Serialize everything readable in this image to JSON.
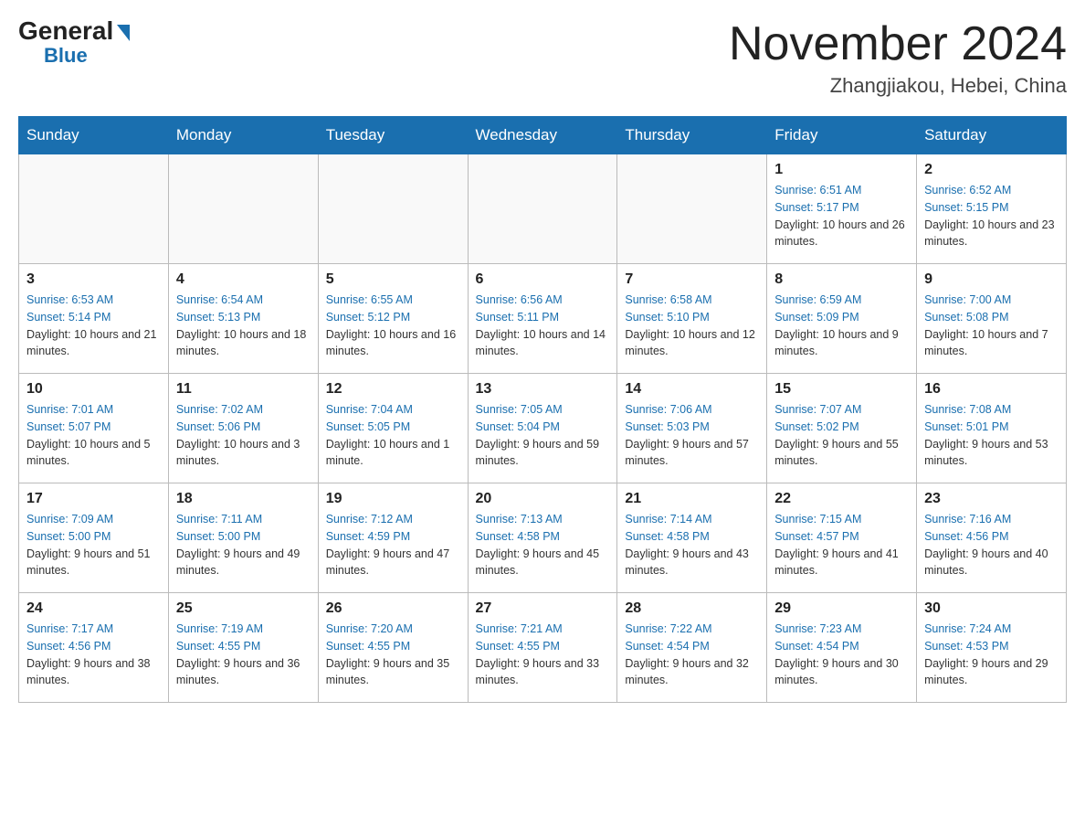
{
  "logo": {
    "general": "General",
    "blue": "Blue",
    "triangle": "▶"
  },
  "title": "November 2024",
  "location": "Zhangjiakou, Hebei, China",
  "weekdays": [
    "Sunday",
    "Monday",
    "Tuesday",
    "Wednesday",
    "Thursday",
    "Friday",
    "Saturday"
  ],
  "weeks": [
    [
      {
        "day": "",
        "sunrise": "",
        "sunset": "",
        "daylight": ""
      },
      {
        "day": "",
        "sunrise": "",
        "sunset": "",
        "daylight": ""
      },
      {
        "day": "",
        "sunrise": "",
        "sunset": "",
        "daylight": ""
      },
      {
        "day": "",
        "sunrise": "",
        "sunset": "",
        "daylight": ""
      },
      {
        "day": "",
        "sunrise": "",
        "sunset": "",
        "daylight": ""
      },
      {
        "day": "1",
        "sunrise": "Sunrise: 6:51 AM",
        "sunset": "Sunset: 5:17 PM",
        "daylight": "Daylight: 10 hours and 26 minutes."
      },
      {
        "day": "2",
        "sunrise": "Sunrise: 6:52 AM",
        "sunset": "Sunset: 5:15 PM",
        "daylight": "Daylight: 10 hours and 23 minutes."
      }
    ],
    [
      {
        "day": "3",
        "sunrise": "Sunrise: 6:53 AM",
        "sunset": "Sunset: 5:14 PM",
        "daylight": "Daylight: 10 hours and 21 minutes."
      },
      {
        "day": "4",
        "sunrise": "Sunrise: 6:54 AM",
        "sunset": "Sunset: 5:13 PM",
        "daylight": "Daylight: 10 hours and 18 minutes."
      },
      {
        "day": "5",
        "sunrise": "Sunrise: 6:55 AM",
        "sunset": "Sunset: 5:12 PM",
        "daylight": "Daylight: 10 hours and 16 minutes."
      },
      {
        "day": "6",
        "sunrise": "Sunrise: 6:56 AM",
        "sunset": "Sunset: 5:11 PM",
        "daylight": "Daylight: 10 hours and 14 minutes."
      },
      {
        "day": "7",
        "sunrise": "Sunrise: 6:58 AM",
        "sunset": "Sunset: 5:10 PM",
        "daylight": "Daylight: 10 hours and 12 minutes."
      },
      {
        "day": "8",
        "sunrise": "Sunrise: 6:59 AM",
        "sunset": "Sunset: 5:09 PM",
        "daylight": "Daylight: 10 hours and 9 minutes."
      },
      {
        "day": "9",
        "sunrise": "Sunrise: 7:00 AM",
        "sunset": "Sunset: 5:08 PM",
        "daylight": "Daylight: 10 hours and 7 minutes."
      }
    ],
    [
      {
        "day": "10",
        "sunrise": "Sunrise: 7:01 AM",
        "sunset": "Sunset: 5:07 PM",
        "daylight": "Daylight: 10 hours and 5 minutes."
      },
      {
        "day": "11",
        "sunrise": "Sunrise: 7:02 AM",
        "sunset": "Sunset: 5:06 PM",
        "daylight": "Daylight: 10 hours and 3 minutes."
      },
      {
        "day": "12",
        "sunrise": "Sunrise: 7:04 AM",
        "sunset": "Sunset: 5:05 PM",
        "daylight": "Daylight: 10 hours and 1 minute."
      },
      {
        "day": "13",
        "sunrise": "Sunrise: 7:05 AM",
        "sunset": "Sunset: 5:04 PM",
        "daylight": "Daylight: 9 hours and 59 minutes."
      },
      {
        "day": "14",
        "sunrise": "Sunrise: 7:06 AM",
        "sunset": "Sunset: 5:03 PM",
        "daylight": "Daylight: 9 hours and 57 minutes."
      },
      {
        "day": "15",
        "sunrise": "Sunrise: 7:07 AM",
        "sunset": "Sunset: 5:02 PM",
        "daylight": "Daylight: 9 hours and 55 minutes."
      },
      {
        "day": "16",
        "sunrise": "Sunrise: 7:08 AM",
        "sunset": "Sunset: 5:01 PM",
        "daylight": "Daylight: 9 hours and 53 minutes."
      }
    ],
    [
      {
        "day": "17",
        "sunrise": "Sunrise: 7:09 AM",
        "sunset": "Sunset: 5:00 PM",
        "daylight": "Daylight: 9 hours and 51 minutes."
      },
      {
        "day": "18",
        "sunrise": "Sunrise: 7:11 AM",
        "sunset": "Sunset: 5:00 PM",
        "daylight": "Daylight: 9 hours and 49 minutes."
      },
      {
        "day": "19",
        "sunrise": "Sunrise: 7:12 AM",
        "sunset": "Sunset: 4:59 PM",
        "daylight": "Daylight: 9 hours and 47 minutes."
      },
      {
        "day": "20",
        "sunrise": "Sunrise: 7:13 AM",
        "sunset": "Sunset: 4:58 PM",
        "daylight": "Daylight: 9 hours and 45 minutes."
      },
      {
        "day": "21",
        "sunrise": "Sunrise: 7:14 AM",
        "sunset": "Sunset: 4:58 PM",
        "daylight": "Daylight: 9 hours and 43 minutes."
      },
      {
        "day": "22",
        "sunrise": "Sunrise: 7:15 AM",
        "sunset": "Sunset: 4:57 PM",
        "daylight": "Daylight: 9 hours and 41 minutes."
      },
      {
        "day": "23",
        "sunrise": "Sunrise: 7:16 AM",
        "sunset": "Sunset: 4:56 PM",
        "daylight": "Daylight: 9 hours and 40 minutes."
      }
    ],
    [
      {
        "day": "24",
        "sunrise": "Sunrise: 7:17 AM",
        "sunset": "Sunset: 4:56 PM",
        "daylight": "Daylight: 9 hours and 38 minutes."
      },
      {
        "day": "25",
        "sunrise": "Sunrise: 7:19 AM",
        "sunset": "Sunset: 4:55 PM",
        "daylight": "Daylight: 9 hours and 36 minutes."
      },
      {
        "day": "26",
        "sunrise": "Sunrise: 7:20 AM",
        "sunset": "Sunset: 4:55 PM",
        "daylight": "Daylight: 9 hours and 35 minutes."
      },
      {
        "day": "27",
        "sunrise": "Sunrise: 7:21 AM",
        "sunset": "Sunset: 4:55 PM",
        "daylight": "Daylight: 9 hours and 33 minutes."
      },
      {
        "day": "28",
        "sunrise": "Sunrise: 7:22 AM",
        "sunset": "Sunset: 4:54 PM",
        "daylight": "Daylight: 9 hours and 32 minutes."
      },
      {
        "day": "29",
        "sunrise": "Sunrise: 7:23 AM",
        "sunset": "Sunset: 4:54 PM",
        "daylight": "Daylight: 9 hours and 30 minutes."
      },
      {
        "day": "30",
        "sunrise": "Sunrise: 7:24 AM",
        "sunset": "Sunset: 4:53 PM",
        "daylight": "Daylight: 9 hours and 29 minutes."
      }
    ]
  ]
}
